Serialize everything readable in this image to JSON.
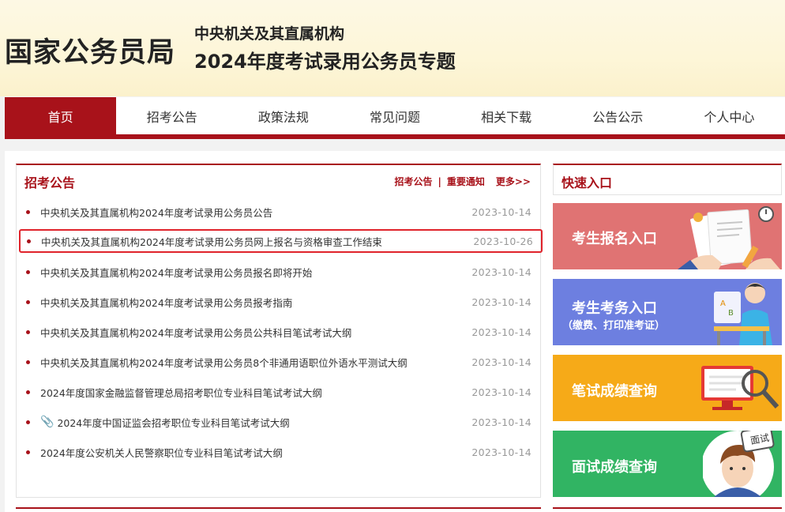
{
  "header": {
    "logo": "国家公务员局",
    "subtitle1": "中央机关及其直属机构",
    "subtitle2": "2024年度考试录用公务员专题"
  },
  "nav": [
    "首页",
    "招考公告",
    "政策法规",
    "常见问题",
    "相关下载",
    "公告公示",
    "个人中心"
  ],
  "notices": {
    "title": "招考公告",
    "link1": "招考公告",
    "link2": "重要通知",
    "more": "更多>>",
    "items": [
      {
        "title": "中央机关及其直属机构2024年度考试录用公务员公告",
        "date": "2023-10-14"
      },
      {
        "title": "中央机关及其直属机构2024年度考试录用公务员网上报名与资格审查工作结束",
        "date": "2023-10-26"
      },
      {
        "title": "中央机关及其直属机构2024年度考试录用公务员报名即将开始",
        "date": "2023-10-14"
      },
      {
        "title": "中央机关及其直属机构2024年度考试录用公务员报考指南",
        "date": "2023-10-14"
      },
      {
        "title": "中央机关及其直属机构2024年度考试录用公务员公共科目笔试考试大纲",
        "date": "2023-10-14"
      },
      {
        "title": "中央机关及其直属机构2024年度考试录用公务员8个非通用语职位外语水平测试大纲",
        "date": "2023-10-14"
      },
      {
        "title": "2024年度国家金融监督管理总局招考职位专业科目笔试考试大纲",
        "date": "2023-10-14"
      },
      {
        "title": "2024年度中国证监会招考职位专业科目笔试考试大纲",
        "date": "2023-10-14"
      },
      {
        "title": "2024年度公安机关人民警察职位专业科目笔试考试大纲",
        "date": "2023-10-14"
      }
    ]
  },
  "quick": {
    "title": "快速入口",
    "card1": "考生报名入口",
    "card2_line1": "考生考务入口",
    "card2_line2": "（缴费、打印准考证）",
    "card3": "笔试成绩查询",
    "card4": "面试成绩查询",
    "card4_badge": "面试"
  },
  "colors": {
    "accent": "#a8121a",
    "highlight": "#e0232b"
  }
}
